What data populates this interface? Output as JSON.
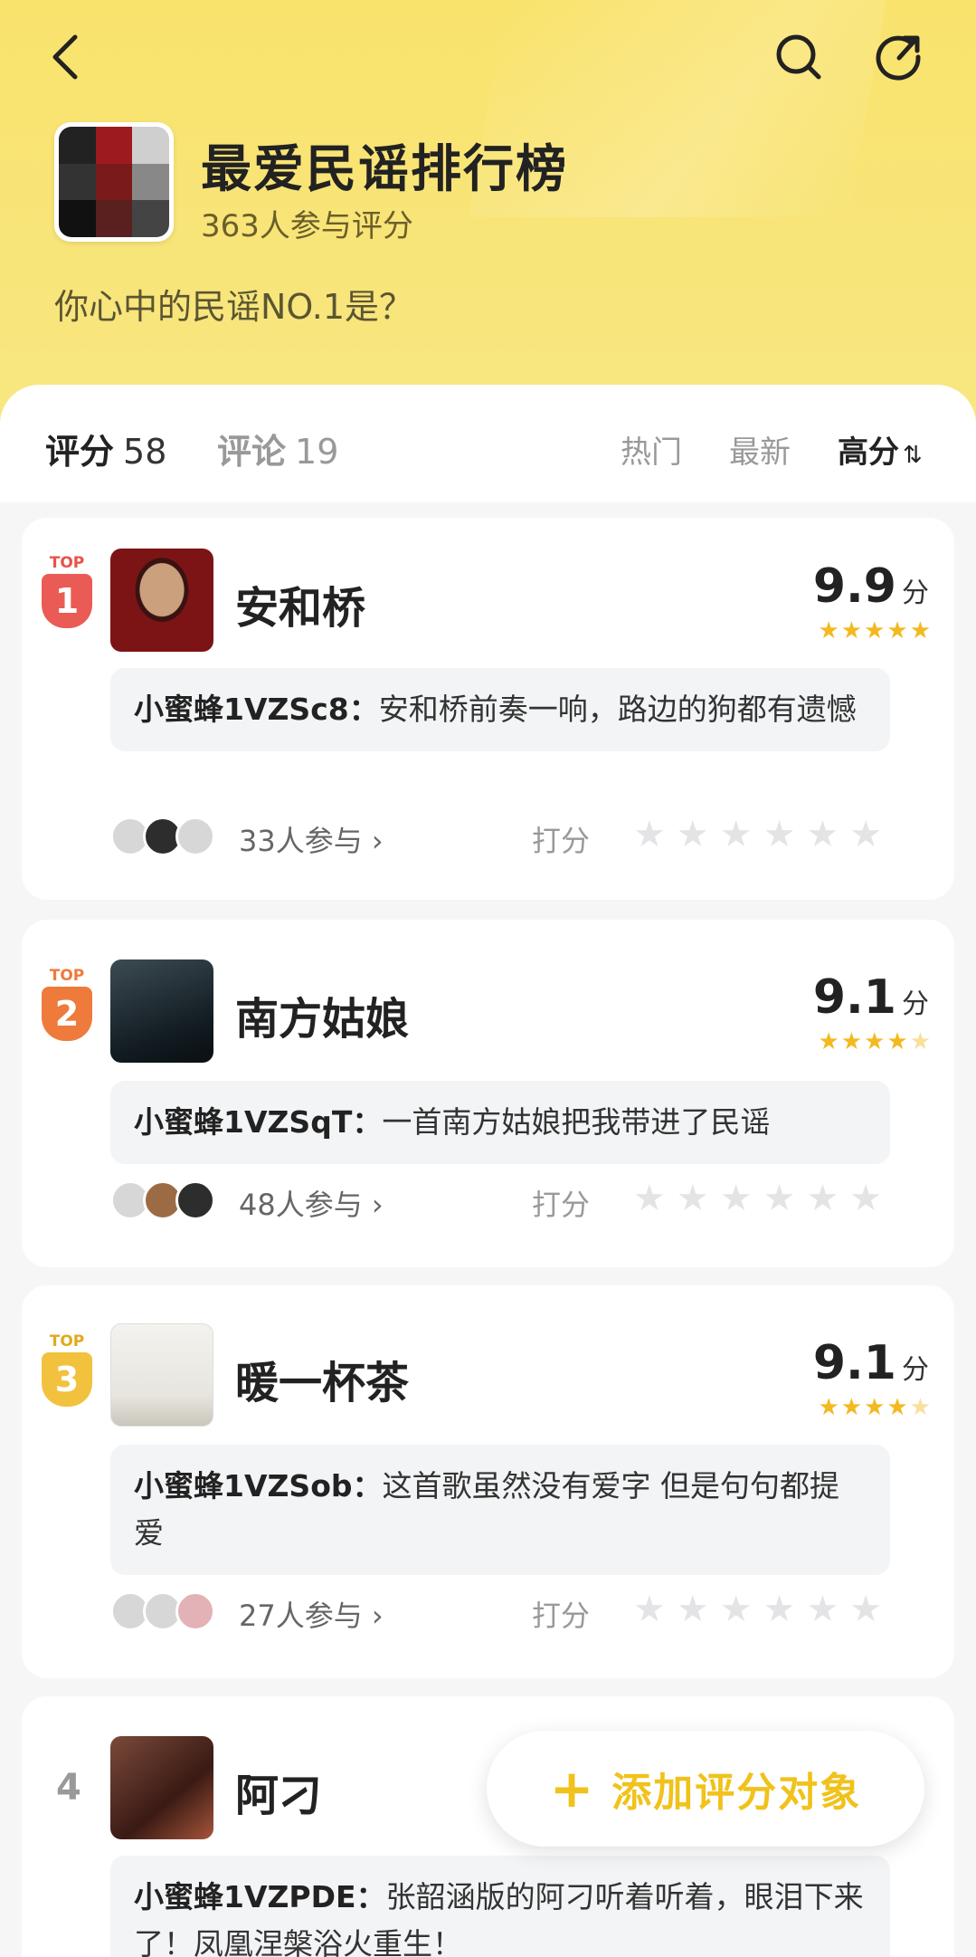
{
  "header": {
    "title": "最爱民谣排行榜",
    "participants": "363人参与评分",
    "subtitle": "你心中的民谣NO.1是？"
  },
  "tabs": [
    {
      "label": "评分",
      "count": "58"
    },
    {
      "label": "评论",
      "count": "19"
    }
  ],
  "sort": {
    "hot": "热门",
    "new": "最新",
    "high": "高分",
    "high_arrows": "⇅"
  },
  "items": [
    {
      "rank_label": "1",
      "top_text": "TOP",
      "title": "安和桥",
      "score": "9.9",
      "unit": "分",
      "commenter": "小蜜蜂1VZSc8：",
      "comment": "安和桥前奏一响，路边的狗都有遗憾",
      "participants": "33人参与 ›",
      "rate_label": "打分"
    },
    {
      "rank_label": "2",
      "top_text": "TOP",
      "title": "南方姑娘",
      "score": "9.1",
      "unit": "分",
      "commenter": "小蜜蜂1VZSqT：",
      "comment": "一首南方姑娘把我带进了民谣",
      "participants": "48人参与 ›",
      "rate_label": "打分"
    },
    {
      "rank_label": "3",
      "top_text": "TOP",
      "title": "暖一杯茶",
      "score": "9.1",
      "unit": "分",
      "commenter": "小蜜蜂1VZSob：",
      "comment": "这首歌虽然没有爱字 但是句句都提爱",
      "participants": "27人参与 ›",
      "rate_label": "打分"
    },
    {
      "rank_label": "4",
      "title": "阿刁",
      "commenter": "小蜜蜂1VZPDE：",
      "comment": "张韶涵版的阿刁听着听着，眼泪下来了！凤凰涅槃浴火重生！"
    }
  ],
  "fab": {
    "plus": "+",
    "label": "添加评分对象"
  },
  "colors": {
    "header_bg": "#f9e36d",
    "accent": "#f0c21b",
    "star": "#f3b920",
    "rank1": "#ea5b55",
    "rank2": "#ee7b3c",
    "rank3": "#f2c23f"
  },
  "icons": [
    "back-arrow-icon",
    "search-icon",
    "share-icon",
    "star-icon"
  ]
}
